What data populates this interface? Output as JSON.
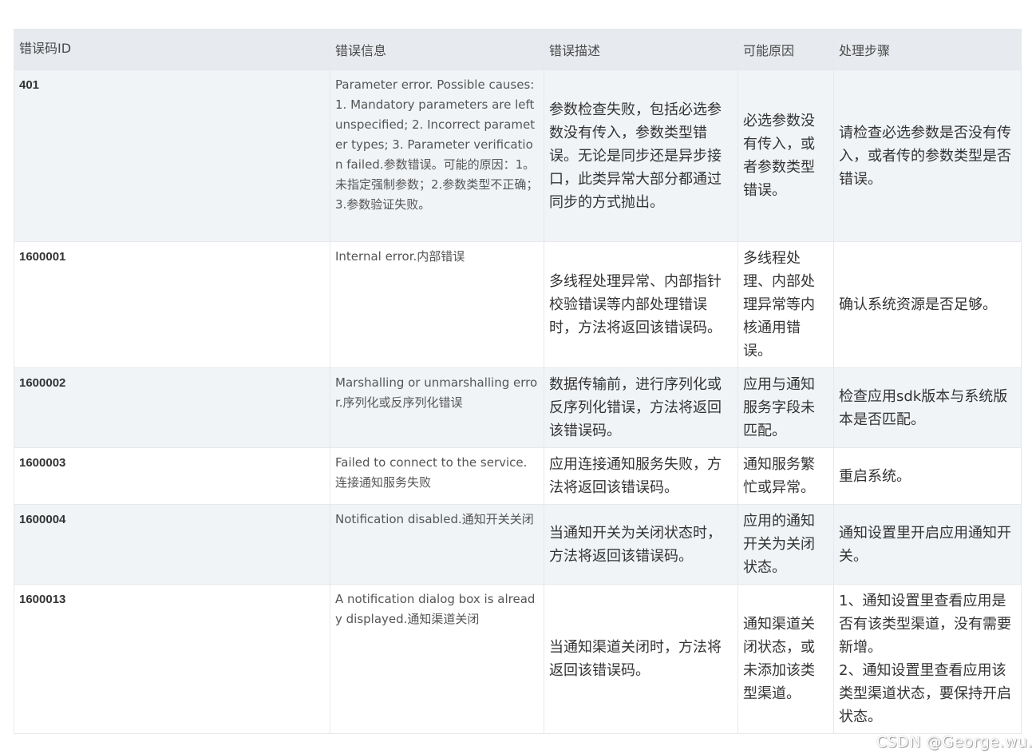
{
  "table": {
    "headers": {
      "code": "错误码ID",
      "message": "错误信息",
      "description": "错误描述",
      "cause": "可能原因",
      "steps": "处理步骤"
    },
    "rows": [
      {
        "code": "401",
        "message": "Parameter error. Possible causes: 1. Mandatory parameters are left unspecified; 2. Incorrect parameter types; 3. Parameter verification failed.参数错误。可能的原因：1。未指定强制参数；2.参数类型不正确；3.参数验证失败。",
        "description": "参数检查失败，包括必选参数没有传入，参数类型错误。无论是同步还是异步接口，此类异常大部分都通过同步的方式抛出。",
        "cause": "必选参数没有传入，或者参数类型错误。",
        "steps": "请检查必选参数是否没有传入，或者传的参数类型是否错误。"
      },
      {
        "code": "1600001",
        "message": "Internal error.内部错误",
        "description": "多线程处理异常、内部指针校验错误等内部处理错误时，方法将返回该错误码。",
        "cause": "多线程处理、内部处理异常等内核通用错误。",
        "steps": "确认系统资源是否足够。"
      },
      {
        "code": "1600002",
        "message": "Marshalling or unmarshalling error.序列化或反序列化错误",
        "description": "数据传输前，进行序列化或反序列化错误，方法将返回该错误码。",
        "cause": "应用与通知服务字段未匹配。",
        "steps": "检查应用sdk版本与系统版本是否匹配。"
      },
      {
        "code": "1600003",
        "message": "Failed to connect to the service.连接通知服务失败",
        "description": "应用连接通知服务失败，方法将返回该错误码。",
        "cause": "通知服务繁忙或异常。",
        "steps": "重启系统。"
      },
      {
        "code": "1600004",
        "message": "Notification disabled.通知开关关闭",
        "description": "当通知开关为关闭状态时，方法将返回该错误码。",
        "cause": "应用的通知开关为关闭状态。",
        "steps": "通知设置里开启应用通知开关。"
      },
      {
        "code": "1600013",
        "message": "A notification dialog box is already displayed.通知渠道关闭",
        "description": "当通知渠道关闭时，方法将返回该错误码。",
        "cause": "通知渠道关闭状态，或未添加该类型渠道。",
        "steps_lines": [
          "1、通知设置里查看应用是否有该类型渠道，没有需要新增。",
          "2、通知设置里查看应用该类型渠道状态，要保持开启状态。"
        ]
      }
    ]
  },
  "watermark": "CSDN @George.wu."
}
